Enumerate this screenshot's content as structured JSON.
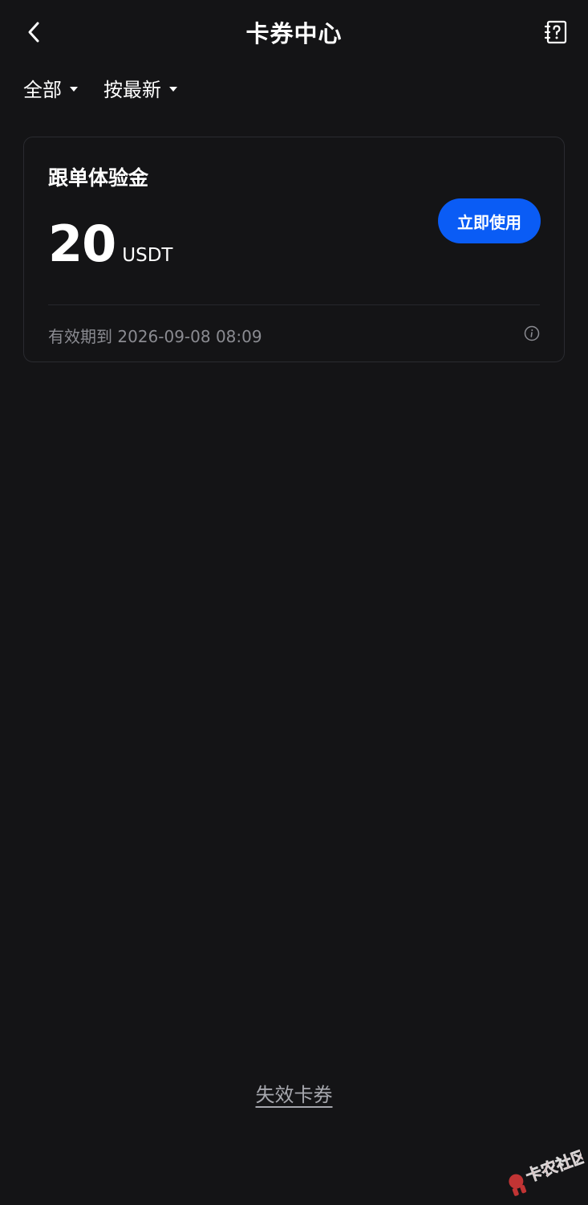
{
  "header": {
    "title": "卡券中心",
    "back_icon": "chevron-left-icon",
    "help_icon": "help-book-icon"
  },
  "filters": [
    {
      "label": "全部"
    },
    {
      "label": "按最新"
    }
  ],
  "coupon": {
    "title": "跟单体验金",
    "amount": "20",
    "unit": "USDT",
    "action_label": "立即使用",
    "expiry": "有效期到 2026-09-08 08:09"
  },
  "footer": {
    "expired_link": "失效卡券"
  },
  "watermark": {
    "text": "卡农社区"
  },
  "colors": {
    "background": "#141416",
    "card_border": "#2a2b30",
    "accent": "#0a5cf5",
    "muted_text": "#8a8b91",
    "watermark": "#e03a3a"
  }
}
